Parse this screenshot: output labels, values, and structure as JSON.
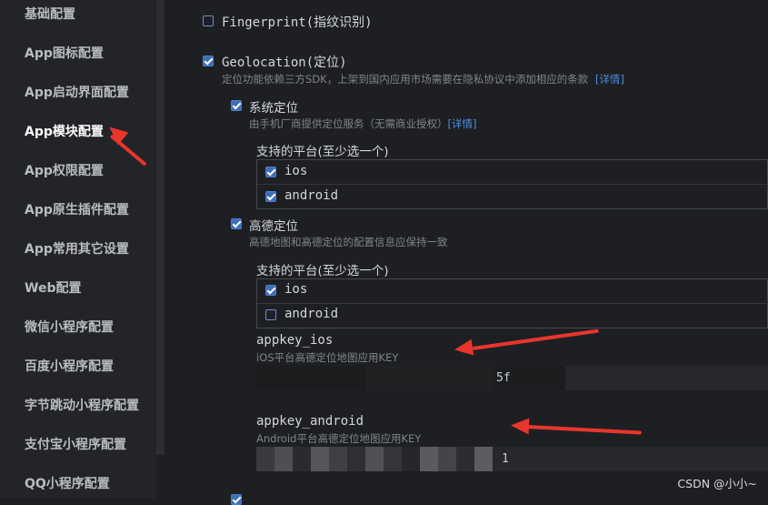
{
  "sidebar": {
    "items": [
      {
        "label": "基础配置"
      },
      {
        "label": "App图标配置"
      },
      {
        "label": "App启动界面配置"
      },
      {
        "label": "App模块配置",
        "active": true
      },
      {
        "label": "App权限配置"
      },
      {
        "label": "App原生插件配置"
      },
      {
        "label": "App常用其它设置"
      },
      {
        "label": "Web配置"
      },
      {
        "label": "微信小程序配置"
      },
      {
        "label": "百度小程序配置"
      },
      {
        "label": "字节跳动小程序配置"
      },
      {
        "label": "支付宝小程序配置"
      },
      {
        "label": "QQ小程序配置"
      }
    ]
  },
  "modules": {
    "fingerprint": {
      "label": "Fingerprint(指纹识别)",
      "checked": false
    },
    "geolocation": {
      "label": "Geolocation(定位)",
      "checked": true,
      "desc": "定位功能依赖三方SDK，上架到国内应用市场需要在隐私协议中添加相应的条款",
      "link": "[详情]",
      "system": {
        "label": "系统定位",
        "checked": true,
        "desc": "由手机厂商提供定位服务（无需商业授权）",
        "link": "[详情]",
        "platforms_title": "支持的平台(至少选一个)",
        "platforms": [
          {
            "label": "ios",
            "checked": true
          },
          {
            "label": "android",
            "checked": true
          }
        ]
      },
      "amap": {
        "label": "高德定位",
        "checked": true,
        "desc": "高德地图和高德定位的配置信息应保持一致",
        "platforms_title": "支持的平台(至少选一个)",
        "platforms": [
          {
            "label": "ios",
            "checked": true
          },
          {
            "label": "android",
            "checked": false
          }
        ],
        "appkey_ios": {
          "label": "appkey_ios",
          "desc": "iOS平台高德定位地图应用KEY",
          "value_suffix": "5f"
        },
        "appkey_android": {
          "label": "appkey_android",
          "desc": "Android平台高德定位地图应用KEY",
          "value_suffix": "1"
        }
      }
    }
  },
  "annotation_color": "#e8362c",
  "accent_color": "#3d6fb8",
  "watermark": "CSDN @小小~"
}
